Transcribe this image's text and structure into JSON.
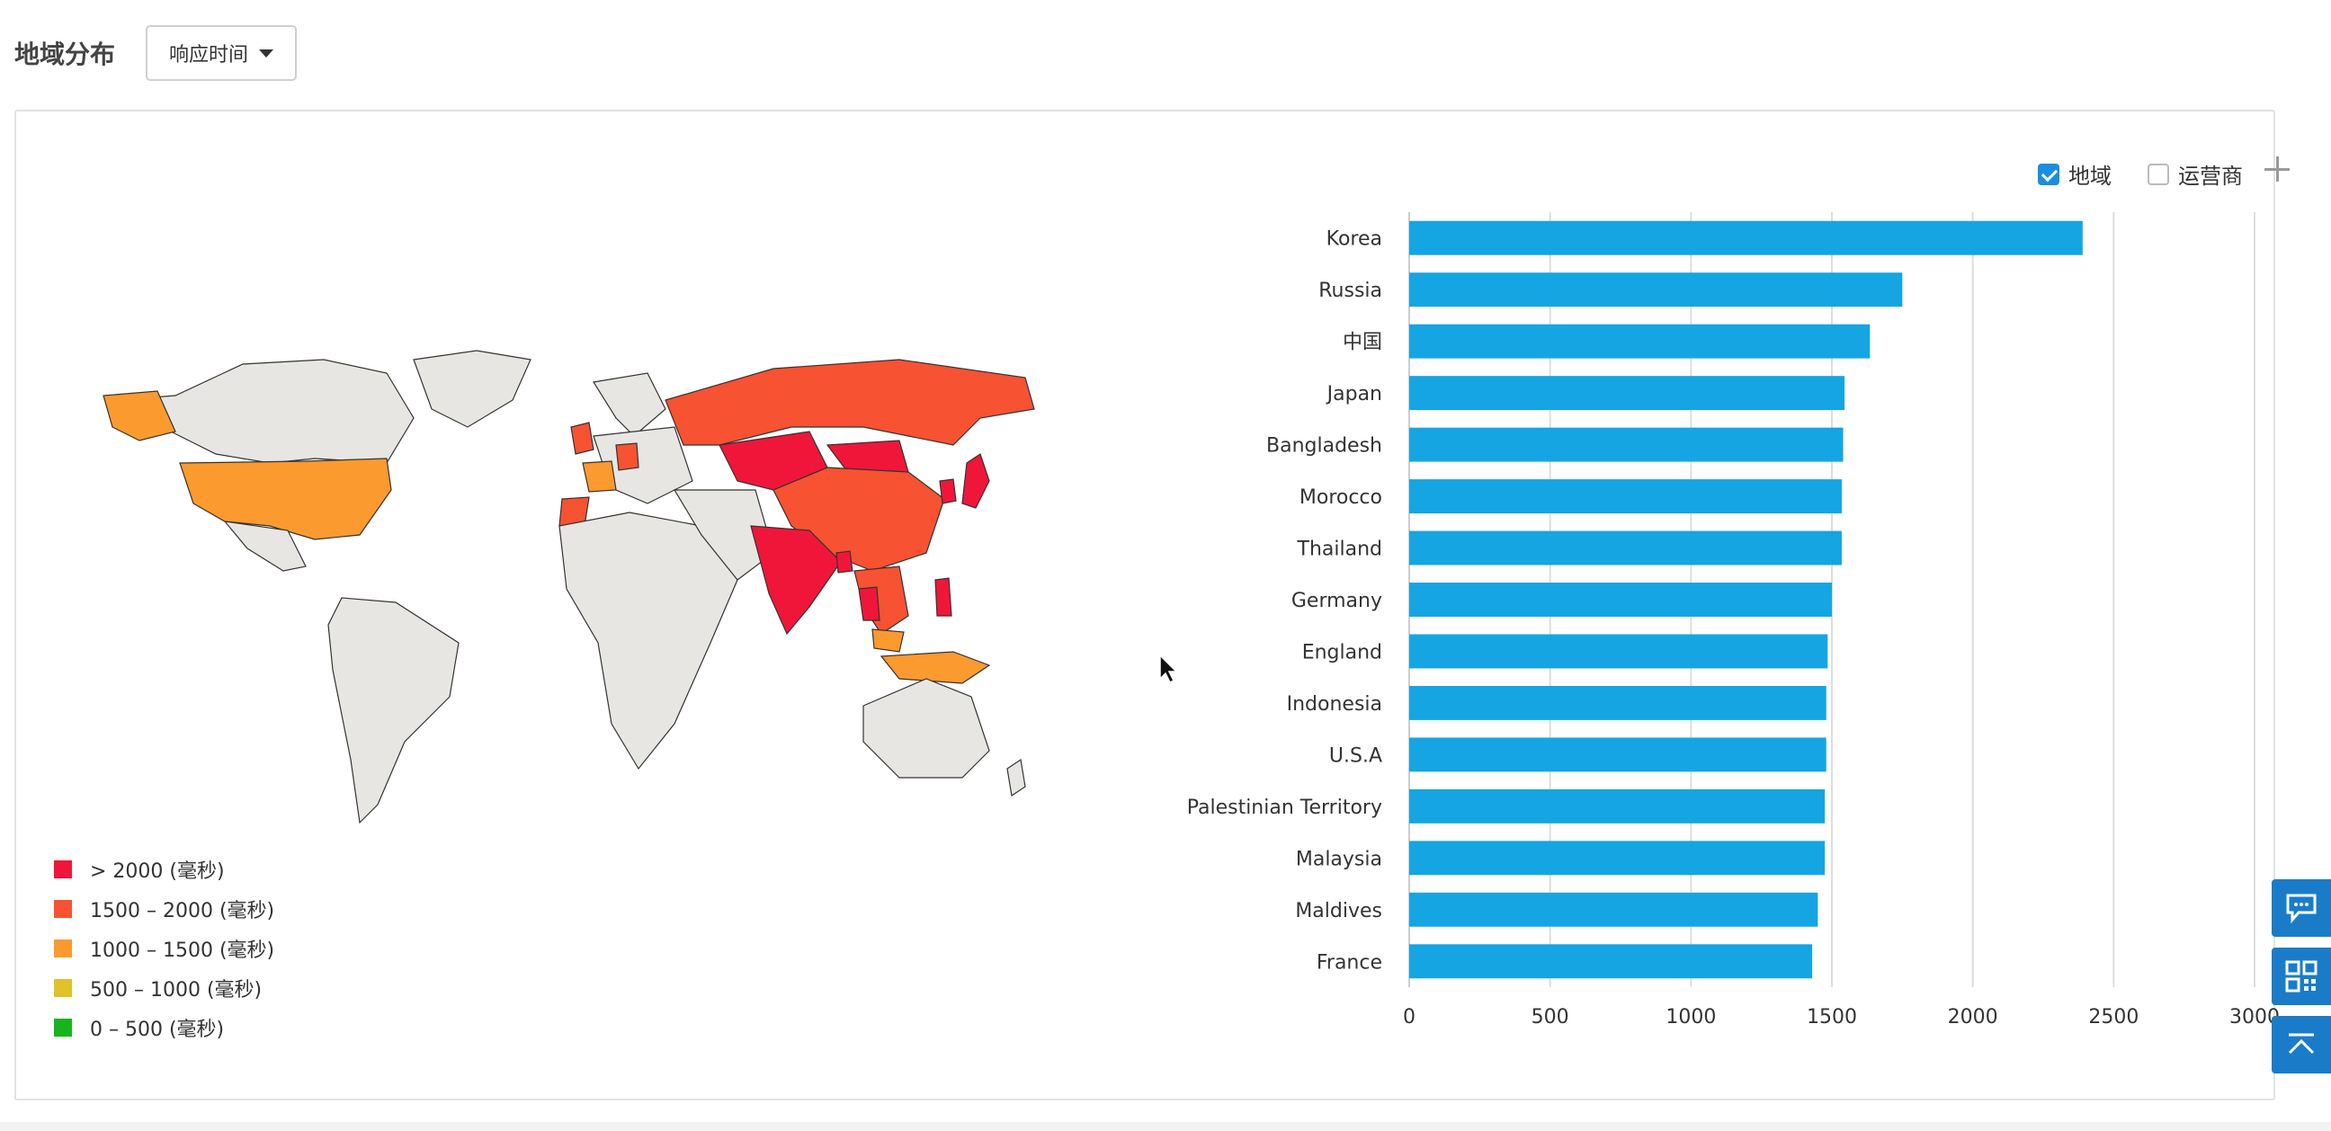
{
  "header": {
    "title": "地域分布",
    "metric_dropdown": "响应时间"
  },
  "toggles": [
    {
      "label": "地域",
      "checked": true
    },
    {
      "label": "运营商",
      "checked": false
    }
  ],
  "legend": [
    {
      "label": "> 2000 (毫秒)",
      "color": "#f0163a"
    },
    {
      "label": "1500 – 2000 (毫秒)",
      "color": "#f75232"
    },
    {
      "label": "1000 – 1500 (毫秒)",
      "color": "#fb9a2f"
    },
    {
      "label": "500 – 1000 (毫秒)",
      "color": "#e0c22a"
    },
    {
      "label": "0 – 500 (毫秒)",
      "color": "#17b51b"
    }
  ],
  "map_colors": {
    "neutral": "#e8e6e3",
    "border": "#333333"
  },
  "chart_data": {
    "type": "bar",
    "orientation": "horizontal",
    "categories": [
      "Korea",
      "Russia",
      "中国",
      "Japan",
      "Bangladesh",
      "Morocco",
      "Thailand",
      "Germany",
      "England",
      "Indonesia",
      "U.S.A",
      "Palestinian Territory",
      "Malaysia",
      "Maldives",
      "France"
    ],
    "values": [
      2390,
      1750,
      1635,
      1545,
      1540,
      1535,
      1535,
      1500,
      1485,
      1480,
      1480,
      1475,
      1475,
      1450,
      1430
    ],
    "xlim": [
      0,
      3000
    ],
    "xticks": [
      "0",
      "500",
      "1000",
      "1500",
      "2000",
      "2500",
      "3000"
    ],
    "grid": true,
    "bar_color": "#15a5e2"
  }
}
